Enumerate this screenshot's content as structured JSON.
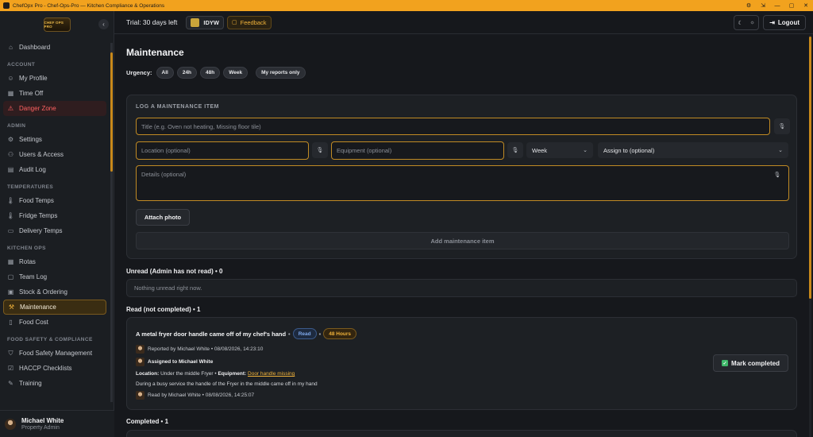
{
  "window": {
    "title": "ChefOpx Pro - Chef-Ops-Pro — Kitchen Compliance & Operations"
  },
  "sidebar": {
    "logo_text": "CHEF OPS PRO",
    "sections": [
      {
        "title": "",
        "items": [
          {
            "label": "Dashboard",
            "icon": "home-icon"
          }
        ]
      },
      {
        "title": "ACCOUNT",
        "items": [
          {
            "label": "My Profile",
            "icon": "user-icon"
          },
          {
            "label": "Time Off",
            "icon": "calendar-icon"
          },
          {
            "label": "Danger Zone",
            "icon": "warning-icon",
            "state": "danger"
          }
        ]
      },
      {
        "title": "ADMIN",
        "items": [
          {
            "label": "Settings",
            "icon": "gear-icon"
          },
          {
            "label": "Users & Access",
            "icon": "users-icon"
          },
          {
            "label": "Audit Log",
            "icon": "log-icon"
          }
        ]
      },
      {
        "title": "TEMPERATURES",
        "items": [
          {
            "label": "Food Temps",
            "icon": "thermometer-icon"
          },
          {
            "label": "Fridge Temps",
            "icon": "thermometer-icon"
          },
          {
            "label": "Delivery Temps",
            "icon": "truck-icon"
          }
        ]
      },
      {
        "title": "KITCHEN OPS",
        "items": [
          {
            "label": "Rotas",
            "icon": "rota-icon"
          },
          {
            "label": "Team Log",
            "icon": "chat-icon"
          },
          {
            "label": "Stock & Ordering",
            "icon": "box-icon"
          },
          {
            "label": "Maintenance",
            "icon": "wrench-icon",
            "state": "active"
          },
          {
            "label": "Food Cost",
            "icon": "document-icon"
          }
        ]
      },
      {
        "title": "FOOD SAFETY & COMPLIANCE",
        "items": [
          {
            "label": "Food Safety Management",
            "icon": "shield-icon"
          },
          {
            "label": "HACCP Checklists",
            "icon": "checklist-icon"
          },
          {
            "label": "Training",
            "icon": "graduation-icon"
          }
        ]
      }
    ],
    "user": {
      "name": "Michael White",
      "role": "Property Admin"
    }
  },
  "topbar": {
    "trial": "Trial: 30 days left",
    "org": "IDYW",
    "feedback": "Feedback",
    "logout": "Logout"
  },
  "main": {
    "title": "Maintenance",
    "urgency": {
      "label": "Urgency:",
      "filters": [
        "All",
        "24h",
        "48h",
        "Week"
      ],
      "my_reports": "My reports only"
    },
    "log_form": {
      "heading": "LOG A MAINTENANCE ITEM",
      "title_placeholder": "Title (e.g. Oven not heating, Missing floor tile)",
      "location_placeholder": "Location (optional)",
      "equipment_placeholder": "Equipment (optional)",
      "urgency_value": "Week",
      "assign_value": "Assign to (optional)",
      "details_placeholder": "Details (optional)",
      "attach_label": "Attach photo",
      "add_label": "Add maintenance item"
    },
    "unread": {
      "title": "Unread (Admin has not read) • 0",
      "empty": "Nothing unread right now."
    },
    "read": {
      "title": "Read (not completed) • 1",
      "task": {
        "title": "A metal fryer door handle came off of my chef's hand",
        "status": "Read",
        "urgency": "48 Hours",
        "reported": "Reported by Michael White • 08/08/2026, 14:23:10",
        "assigned": "Assigned to Michael White",
        "location_label": "Location:",
        "location_value": "Under the middle Fryer",
        "equipment_label": "Equipment:",
        "equipment_value": "Door handle missing",
        "details": "During a busy service the handle of the Fryer in the middle came off in my hand",
        "read_by": "Read by Michael White • 08/08/2026, 14:25:07",
        "complete_label": "Mark completed"
      }
    },
    "completed": {
      "title": "Completed • 1"
    }
  },
  "colors": {
    "accent": "#f2a21e",
    "danger": "#ff6060",
    "background": "#16181c"
  }
}
